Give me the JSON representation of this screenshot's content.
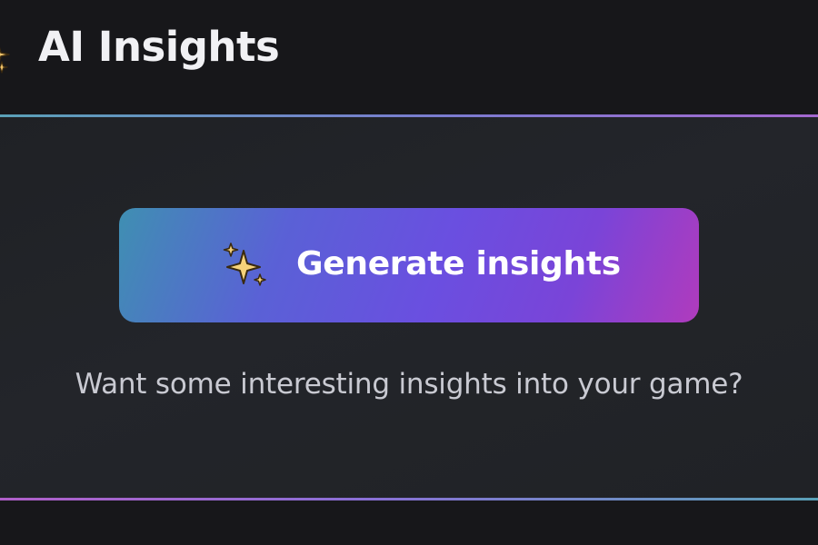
{
  "header": {
    "title": "AI Insights",
    "icon": "sparkles-icon"
  },
  "card": {
    "button_label": "Generate insights",
    "button_icon": "sparkles-icon",
    "prompt": "Want some interesting insights into your game?"
  },
  "colors": {
    "background": "#17171a",
    "panel": "#222428",
    "button_gradient_start": "#3f8fb2",
    "button_gradient_mid": "#6a4fe0",
    "button_gradient_end": "#b03bbd",
    "sparkle": "#f2c46a",
    "text_primary": "#ffffff",
    "text_secondary": "#c9cad2"
  }
}
